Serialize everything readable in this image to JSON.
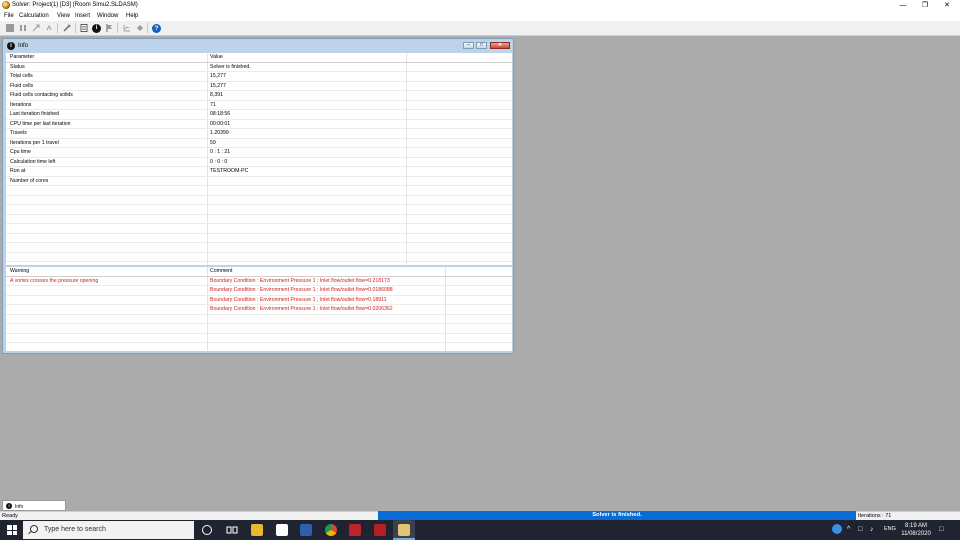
{
  "window": {
    "title": "Solver: Project(1) [D3] (Room Simu2.SLDASM)"
  },
  "menu": [
    "File",
    "Calculation",
    "View",
    "Insert",
    "Window",
    "Help"
  ],
  "info": {
    "title": "Info",
    "params_header": {
      "parameter": "Parameter",
      "value": "Value"
    },
    "params": [
      {
        "name": "Status",
        "value": "Solver is finished."
      },
      {
        "name": "Total cells",
        "value": "15,277"
      },
      {
        "name": "Fluid cells",
        "value": "15,277"
      },
      {
        "name": "Fluid cells contacting solids",
        "value": "8,391"
      },
      {
        "name": "Iterations",
        "value": "71"
      },
      {
        "name": "Last iteration finished",
        "value": "08:18:56"
      },
      {
        "name": "CPU time per last iteration",
        "value": "00:00:01"
      },
      {
        "name": "Travels",
        "value": "1.20399"
      },
      {
        "name": "Iterations per 1 travel",
        "value": "59"
      },
      {
        "name": "Cpu time",
        "value": "0 : 1 : 21"
      },
      {
        "name": "Calculation time left",
        "value": "0 : 0 : 0"
      },
      {
        "name": "Run at",
        "value": "TESTROOM-PC"
      },
      {
        "name": "Number of cores",
        "value": ""
      }
    ],
    "warn_header": {
      "warning": "Warning",
      "comment": "Comment"
    },
    "warnings": [
      {
        "warning": "A vortex crosses the pressure opening",
        "comment": "Boundary Condition : Environment Pressure 1 ; Inlet flow/outlet flow=0.218173"
      },
      {
        "warning": "",
        "comment": "Boundary Condition : Environment Pressure 1 ; Inlet flow/outlet flow=0.0186088"
      },
      {
        "warning": "",
        "comment": "Boundary Condition : Environment Pressure 1 ; Inlet flow/outlet flow=0.18911"
      },
      {
        "warning": "",
        "comment": "Boundary Condition : Environment Pressure 1 ; Inlet flow/outlet flow=0.0206362"
      }
    ]
  },
  "bottom_tab": {
    "label": "Info"
  },
  "status": {
    "ready": "Ready",
    "progress_text": "Solver is finished.",
    "progress": 1.0,
    "iterations": "Iterations : 71"
  },
  "taskbar": {
    "search_placeholder": "Type here to search",
    "lang": "ENG",
    "time": "8:19 AM",
    "date": "11/08/2020"
  },
  "colors": {
    "accent": "#0a6bd6",
    "warning_text": "#d02020",
    "mdi_frame": "#bcd3ea"
  }
}
